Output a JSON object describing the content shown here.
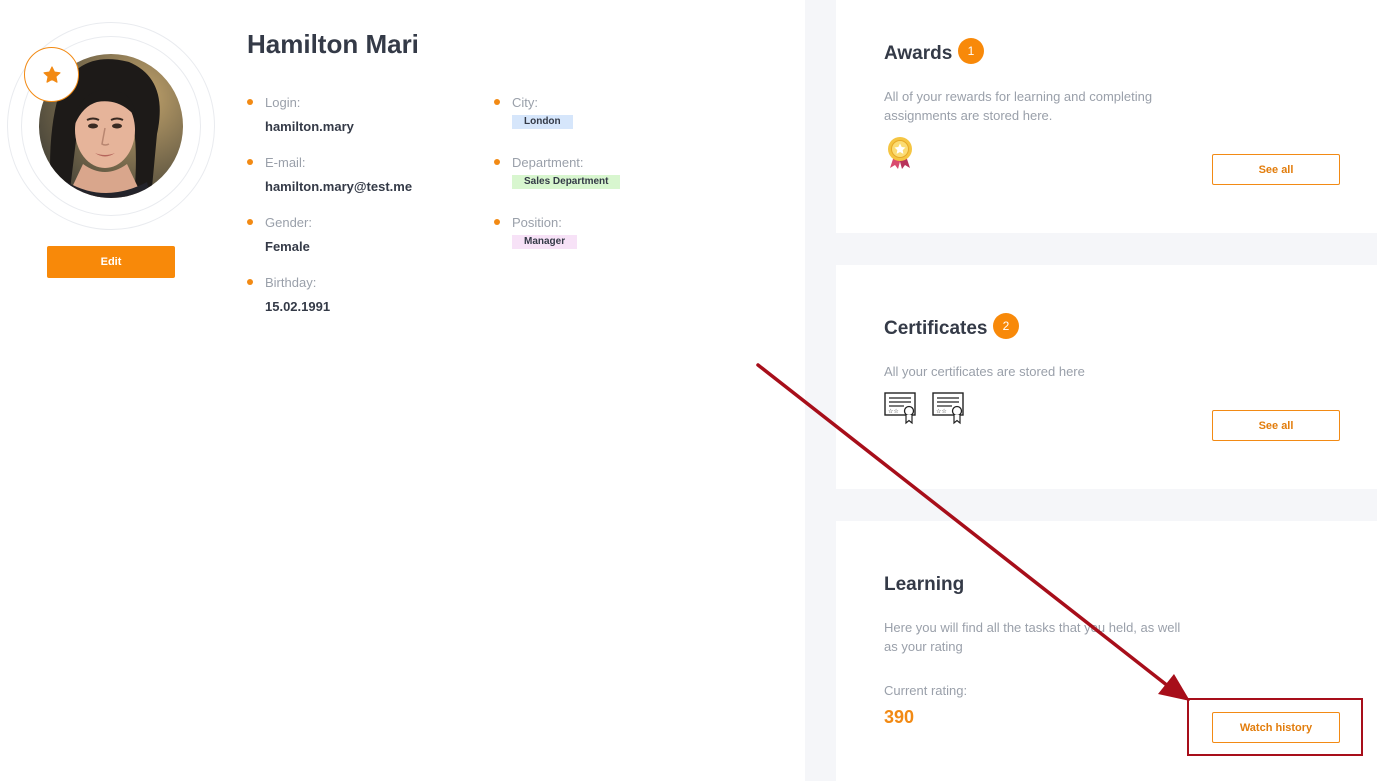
{
  "profile": {
    "name": "Hamilton Mari",
    "edit_label": "Edit",
    "fields": {
      "login": {
        "label": "Login:",
        "value": "hamilton.mary"
      },
      "email": {
        "label": "E-mail:",
        "value": "hamilton.mary@test.me"
      },
      "gender": {
        "label": "Gender:",
        "value": "Female"
      },
      "birthday": {
        "label": "Birthday:",
        "value": "15.02.1991"
      },
      "city": {
        "label": "City:",
        "value": "London"
      },
      "department": {
        "label": "Department:",
        "value": "Sales Department"
      },
      "position": {
        "label": "Position:",
        "value": "Manager"
      }
    }
  },
  "awards": {
    "title": "Awards",
    "count": "1",
    "description": "All of your rewards for learning and completing assignments are stored here.",
    "button_label": "See all",
    "icons": [
      "medal-icon"
    ]
  },
  "certificates": {
    "title": "Certificates",
    "count": "2",
    "description": "All your certificates are stored here",
    "button_label": "See all",
    "icons": [
      "certificate-icon",
      "certificate-icon"
    ]
  },
  "learning": {
    "title": "Learning",
    "description": "Here you will find all the tasks that you held, as well as your rating",
    "rating_label": "Current rating:",
    "rating_value": "390",
    "button_label": "Watch history"
  },
  "colors": {
    "accent": "#f88909",
    "annotation": "#a70e1a",
    "text": "#343a47",
    "muted": "#9aa0aa",
    "panel_bg": "#f5f6f9"
  }
}
